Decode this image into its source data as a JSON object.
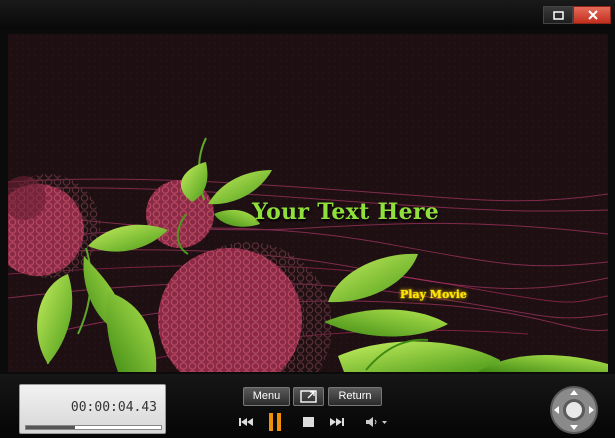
{
  "video": {
    "headline": "Your Text Here",
    "play_link": "Play Movie"
  },
  "controls": {
    "time": "00:00:04.43",
    "progress": 0.36,
    "menu_label": "Menu",
    "return_label": "Return"
  },
  "colors": {
    "headline": "#8fe03a",
    "play_link": "#ffe600",
    "close_button": "#c94a3a"
  },
  "icons": [
    "maximize-icon",
    "close-icon",
    "fullscreen-icon",
    "previous-chapter-icon",
    "pause-icon",
    "stop-icon",
    "next-chapter-icon",
    "volume-icon",
    "dvd-navigation-pad-icon"
  ]
}
